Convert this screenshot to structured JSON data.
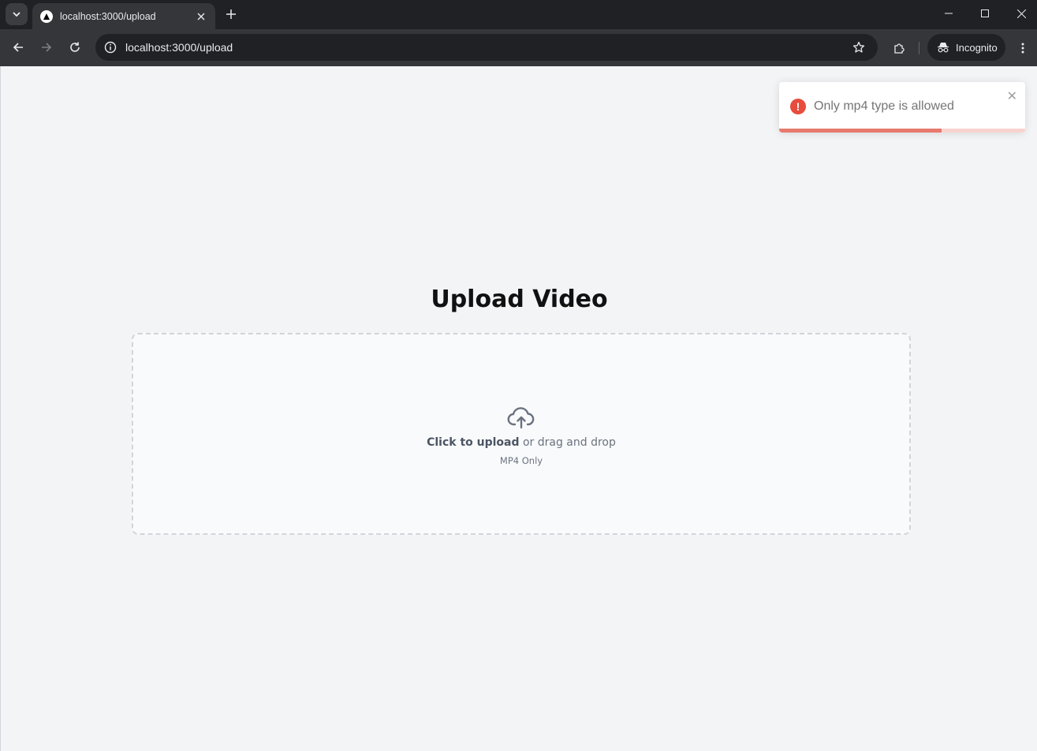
{
  "browser": {
    "tab_title": "localhost:3000/upload",
    "url": "localhost:3000/upload",
    "profile_label": "Incognito"
  },
  "page": {
    "heading": "Upload Video",
    "dropzone": {
      "click_text": "Click to upload",
      "drag_text": " or drag and drop",
      "hint": "MP4 Only"
    }
  },
  "toast": {
    "message": "Only mp4 type is allowed",
    "type": "error",
    "progress_remaining": 0.66,
    "accent_color": "#e74c3c"
  }
}
